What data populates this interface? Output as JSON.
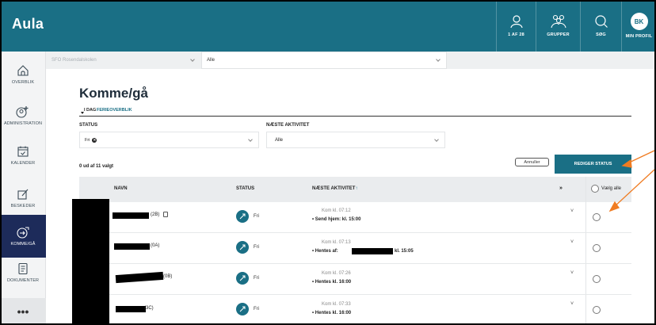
{
  "app": {
    "logo": "Aula"
  },
  "topbar": {
    "items": [
      {
        "label": "1 AF 28",
        "icon": "person-icon"
      },
      {
        "label": "GRUPPER",
        "icon": "groups-icon"
      },
      {
        "label": "SØG",
        "icon": "search-icon"
      },
      {
        "label": "MIN PROFIL",
        "icon": "avatar",
        "initials": "BK"
      }
    ]
  },
  "sidebar": {
    "items": [
      {
        "label": "OVERBLIK",
        "icon": "home-icon"
      },
      {
        "label": "ADMINISTRATION",
        "icon": "admin-icon"
      },
      {
        "label": "KALENDER",
        "icon": "calendar-icon"
      },
      {
        "label": "BESKEDER",
        "icon": "message-icon"
      },
      {
        "label": "KOMME/GÅ",
        "icon": "come-go-icon",
        "active": true
      },
      {
        "label": "DOKUMENTER",
        "icon": "document-icon"
      }
    ],
    "more": "•••"
  },
  "filters": {
    "institution": "SFO Rosendalskolen",
    "group": "Alle"
  },
  "page": {
    "title": "Komme/gå",
    "tabs": {
      "active": "I DAG",
      "other": "FERIEOVERBLIK"
    },
    "status_label": "STATUS",
    "status_chip": "Fri",
    "next_activity_label": "NÆSTE AKTIVITET",
    "next_activity_value": "Alle",
    "selected_count": "0 ud af 11 valgt",
    "cancel_button": "Annuller",
    "edit_button": "REDIGER STATUS"
  },
  "table": {
    "headers": {
      "name": "NAVN",
      "status": "STATUS",
      "next": "NÆSTE AKTIVITET",
      "sort_arrow": "↑",
      "select_all": "Vælg alle"
    },
    "rows": [
      {
        "name_suffix": "(2B)",
        "status": "Fri",
        "arrival": "Kom kl. 07:12",
        "next": "• Send hjem: kl. 15:00",
        "next_tail": "",
        "has_note": true
      },
      {
        "name_suffix": "(0A)",
        "status": "Fri",
        "arrival": "Kom kl. 07:13",
        "next": "• Hentes af:",
        "next_tail": "kl. 15:05",
        "has_note": false
      },
      {
        "name_suffix": "(0B)",
        "status": "Fri",
        "arrival": "Kom kl. 07:26",
        "next": "• Hentes kl. 16:00",
        "next_tail": "",
        "has_note": false
      },
      {
        "name_suffix": "(3C)",
        "status": "Fri",
        "arrival": "Kom kl. 07:33",
        "next": "• Hentes kl. 16:00",
        "next_tail": "",
        "has_note": false
      }
    ]
  },
  "colors": {
    "brand": "#1a6f85",
    "sidebar_active": "#1d2b5a",
    "annotation": "#f07c22"
  }
}
